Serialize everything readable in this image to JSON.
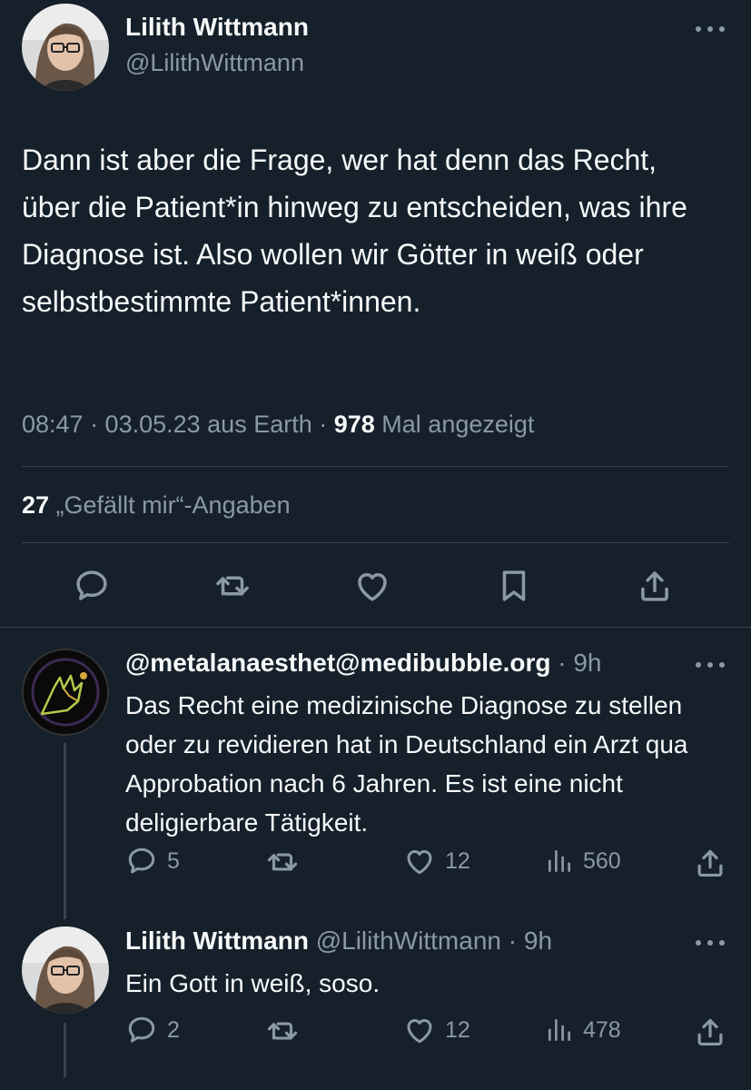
{
  "main_tweet": {
    "author_name": "Lilith Wittmann",
    "author_handle": "@LilithWittmann",
    "text": "Dann ist aber die Frage, wer hat denn das Recht, über die Patient*in hinweg zu entscheiden, was ihre Diagnose ist. Also wollen wir Götter in weiß oder selbstbestimmte Patient*innen.",
    "meta_time": "08:47 · 03.05.23 aus Earth · ",
    "views_count": "978",
    "views_label": " Mal angezeigt",
    "likes_count": "27",
    "likes_label": " „Gefällt mir“-Angaben"
  },
  "replies": [
    {
      "author_name": "@metalanaesthet@medibubble.org",
      "author_handle": "",
      "time": "· 9h",
      "text": "Das Recht eine medizinische Diagnose zu stellen oder zu revidieren hat in Deutschland ein Arzt qua Approbation nach 6 Jahren. Es ist eine nicht deligierbare Tätigkeit.",
      "reply_count": "5",
      "retweet_count": "",
      "like_count": "12",
      "view_count": "560"
    },
    {
      "author_name": "Lilith Wittmann",
      "author_handle": "@LilithWittmann",
      "time": "· 9h",
      "text": "Ein Gott in weiß, soso.",
      "reply_count": "2",
      "retweet_count": "",
      "like_count": "12",
      "view_count": "478"
    }
  ],
  "colors": {
    "background": "#15202b",
    "text": "#f7f9f9",
    "muted": "#8b98a5",
    "divider": "#38444d",
    "thread_line": "#38444d"
  },
  "icons": [
    "more-icon",
    "reply-icon",
    "retweet-icon",
    "like-icon",
    "bookmark-icon",
    "share-icon",
    "views-icon"
  ]
}
